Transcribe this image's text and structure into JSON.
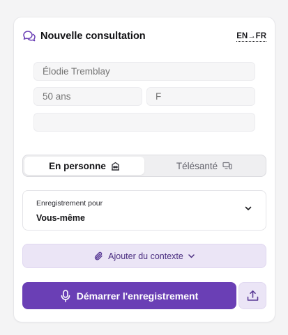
{
  "header": {
    "title": "Nouvelle consultation",
    "lang_toggle": "EN→FR",
    "icon": "chat-bubbles-icon"
  },
  "patient": {
    "name_placeholder": "Élodie Tremblay",
    "age_placeholder": "50 ans",
    "sex_placeholder": "F",
    "extra_value": ""
  },
  "mode": {
    "options": [
      {
        "label": "En personne",
        "icon": "building-icon",
        "selected": true
      },
      {
        "label": "Télésanté",
        "icon": "devices-icon",
        "selected": false
      }
    ]
  },
  "recording_for": {
    "label": "Enregistrement pour",
    "value": "Vous-même",
    "icon": "chevron-down-icon"
  },
  "context": {
    "label": "Ajouter du contexte",
    "icon": "paperclip-icon",
    "chevron": "chevron-down-icon"
  },
  "actions": {
    "record_label": "Démarrer l'enregistrement",
    "record_icon": "microphone-icon",
    "upload_icon": "upload-icon"
  },
  "colors": {
    "accent": "#6a3fb5",
    "accent_soft": "#ebe5f6",
    "accent_text": "#4a2d80"
  }
}
